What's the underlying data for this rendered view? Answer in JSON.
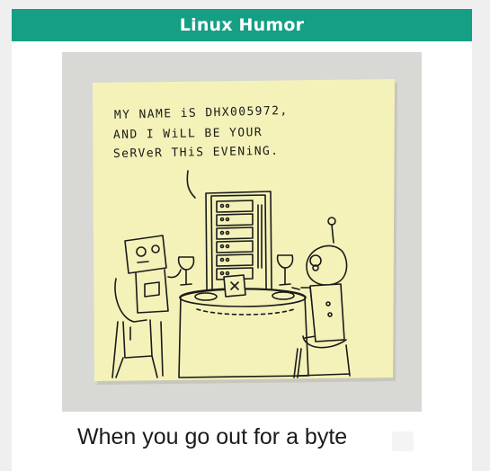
{
  "header": {
    "title": "Linux Humor",
    "accent_color": "#159f84"
  },
  "comic": {
    "speech_line_1": "MY NAME iS DHX005972,",
    "speech_line_2": "AND I WiLL BE YOUR",
    "speech_line_3": "SeRVeR THiS EVENiNG."
  },
  "post": {
    "caption": "When you go out for a byte"
  }
}
